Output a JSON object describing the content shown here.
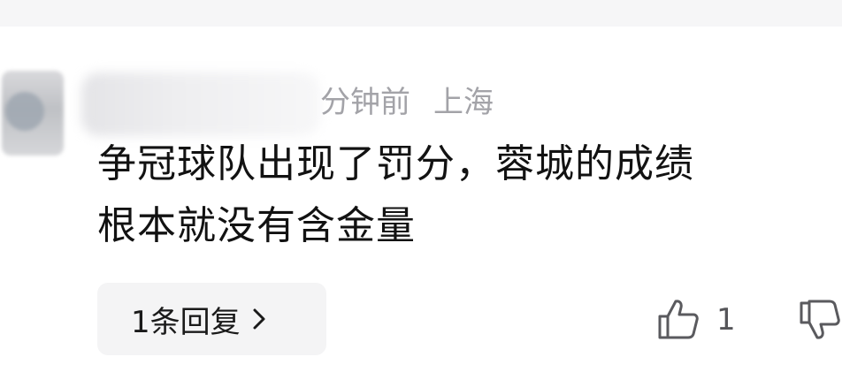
{
  "comment": {
    "time": "分钟前",
    "location": "上海",
    "text_lines": [
      "争冠球队出现了罚分，蓉城的成绩",
      "根本就没有含金量"
    ],
    "reply_button_label": "1条回复",
    "like_count": "1"
  },
  "icons": {
    "reply_chevron": "chevron-right-icon",
    "like": "thumbs-up-icon",
    "dislike": "thumbs-down-icon"
  },
  "colors": {
    "meta_text": "#a3a3a8",
    "reply_button_bg": "#f4f4f5",
    "icon_stroke": "#5a5a5e"
  }
}
